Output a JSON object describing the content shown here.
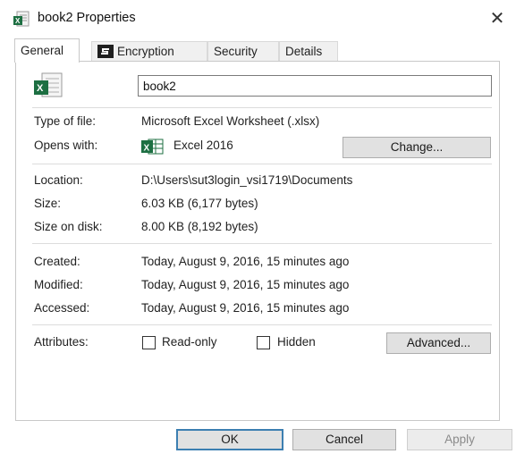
{
  "window": {
    "title": "book2 Properties",
    "close_glyph": "✕",
    "title_icon": "excel-file-icon"
  },
  "tabs": [
    {
      "label": "General",
      "active": true
    },
    {
      "label": "Encryption",
      "active": false
    },
    {
      "label": "Security",
      "active": false
    },
    {
      "label": "Details",
      "active": false
    }
  ],
  "general": {
    "file_name": "book2",
    "type_label": "Type of file:",
    "type_value": "Microsoft Excel Worksheet (.xlsx)",
    "opens_label": "Opens with:",
    "opens_value": "Excel 2016",
    "change_button": "Change...",
    "location_label": "Location:",
    "location_value": "D:\\Users\\sut3login_vsi1719\\Documents",
    "size_label": "Size:",
    "size_value": "6.03 KB (6,177 bytes)",
    "size_on_disk_label": "Size on disk:",
    "size_on_disk_value": "8.00 KB (8,192 bytes)",
    "created_label": "Created:",
    "created_value": "Today, August 9, 2016, 15 minutes ago",
    "modified_label": "Modified:",
    "modified_value": "Today, August 9, 2016, 15 minutes ago",
    "accessed_label": "Accessed:",
    "accessed_value": "Today, August 9, 2016, 15 minutes ago",
    "attributes_label": "Attributes:",
    "readonly_label": "Read-only",
    "readonly_checked": false,
    "hidden_label": "Hidden",
    "hidden_checked": false,
    "advanced_button": "Advanced..."
  },
  "footer": {
    "ok": "OK",
    "cancel": "Cancel",
    "apply": "Apply"
  },
  "colors": {
    "excel_green": "#1d6f42",
    "default_button_border": "#3c7fb1"
  }
}
